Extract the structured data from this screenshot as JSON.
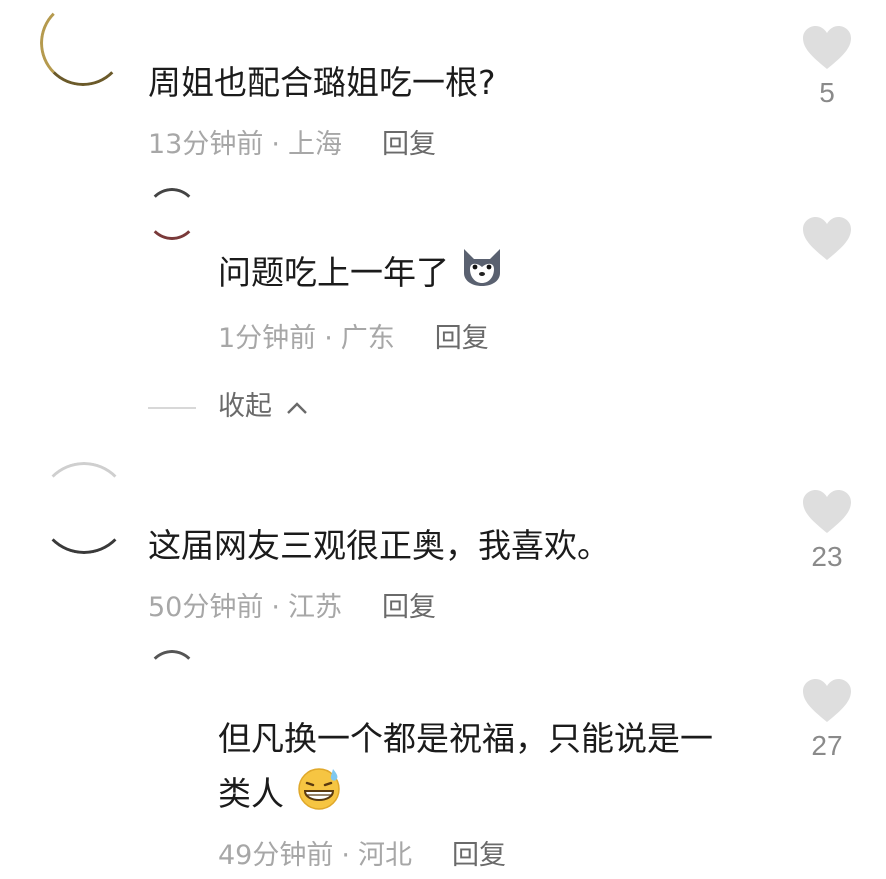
{
  "comments": [
    {
      "text": "周姐也配合璐姐吃一根?",
      "time": "13分钟前",
      "location": "上海",
      "reply_label": "回复",
      "likes": "5"
    },
    {
      "text": "问题吃上一年了",
      "emoji_icon": "wolf-face-icon",
      "time": "1分钟前",
      "location": "广东",
      "reply_label": "回复"
    },
    {
      "collapse_label": "收起"
    },
    {
      "text": "这届网友三观很正奥，我喜欢。",
      "time": "50分钟前",
      "location": "江苏",
      "reply_label": "回复",
      "likes": "23"
    },
    {
      "text_line1": "但凡换一个都是祝福，只能说是一",
      "text_line2": "类人",
      "emoji_icon": "grinning-sweat-icon",
      "time": "49分钟前",
      "location": "河北",
      "reply_label": "回复",
      "likes": "27"
    }
  ],
  "separator": "·",
  "colors": {
    "heart": "#dedede",
    "meta": "#a7a7a7",
    "reply": "#6a6a6a",
    "text": "#1b1b1b"
  }
}
